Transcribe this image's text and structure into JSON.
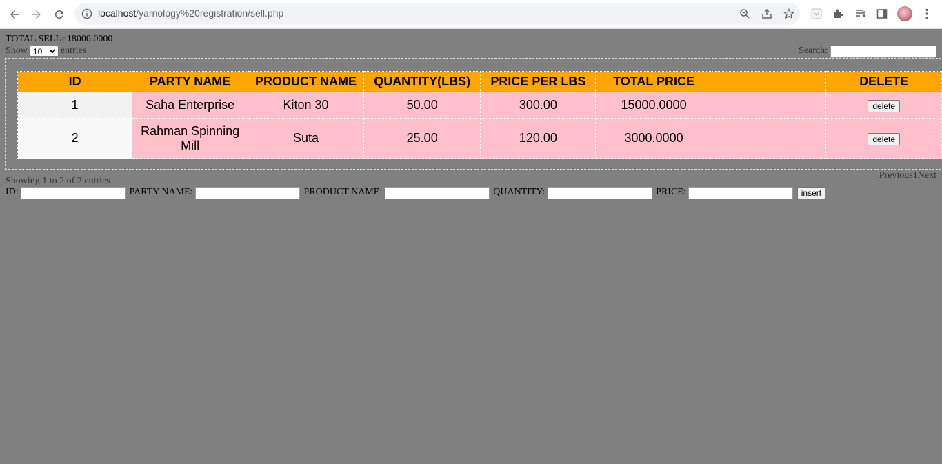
{
  "browser": {
    "url_host": "localhost",
    "url_path": "/yarnology%20registration/sell.php"
  },
  "summary": {
    "total_sell": "TOTAL SELL=18000.0000"
  },
  "length_control": {
    "show_label": "Show",
    "selected": "10",
    "entries_label": "entries"
  },
  "search": {
    "label": "Search:",
    "value": ""
  },
  "table": {
    "headers": [
      "ID",
      "PARTY NAME",
      "PRODUCT NAME",
      "QUANTITY(LBS)",
      "PRICE PER LBS",
      "TOTAL PRICE",
      "",
      "DELETE"
    ],
    "rows": [
      {
        "id": "1",
        "party": "Saha Enterprise",
        "product": "Kiton 30",
        "quantity": "50.00",
        "price": "300.00",
        "total": "15000.0000",
        "blank": "",
        "delete_label": "delete"
      },
      {
        "id": "2",
        "party": "Rahman Spinning Mill",
        "product": "Suta",
        "quantity": "25.00",
        "price": "120.00",
        "total": "3000.0000",
        "blank": "",
        "delete_label": "delete"
      }
    ]
  },
  "footer": {
    "info": "Showing 1 to 2 of 2 entries",
    "previous": "Previous",
    "page": "1",
    "next": "Next"
  },
  "form": {
    "id_label": "ID:",
    "party_label": "PARTY NAME:",
    "product_label": "PRODUCT NAME:",
    "quantity_label": "QUANTITY:",
    "price_label": "PRICE:",
    "submit_label": "insert"
  }
}
